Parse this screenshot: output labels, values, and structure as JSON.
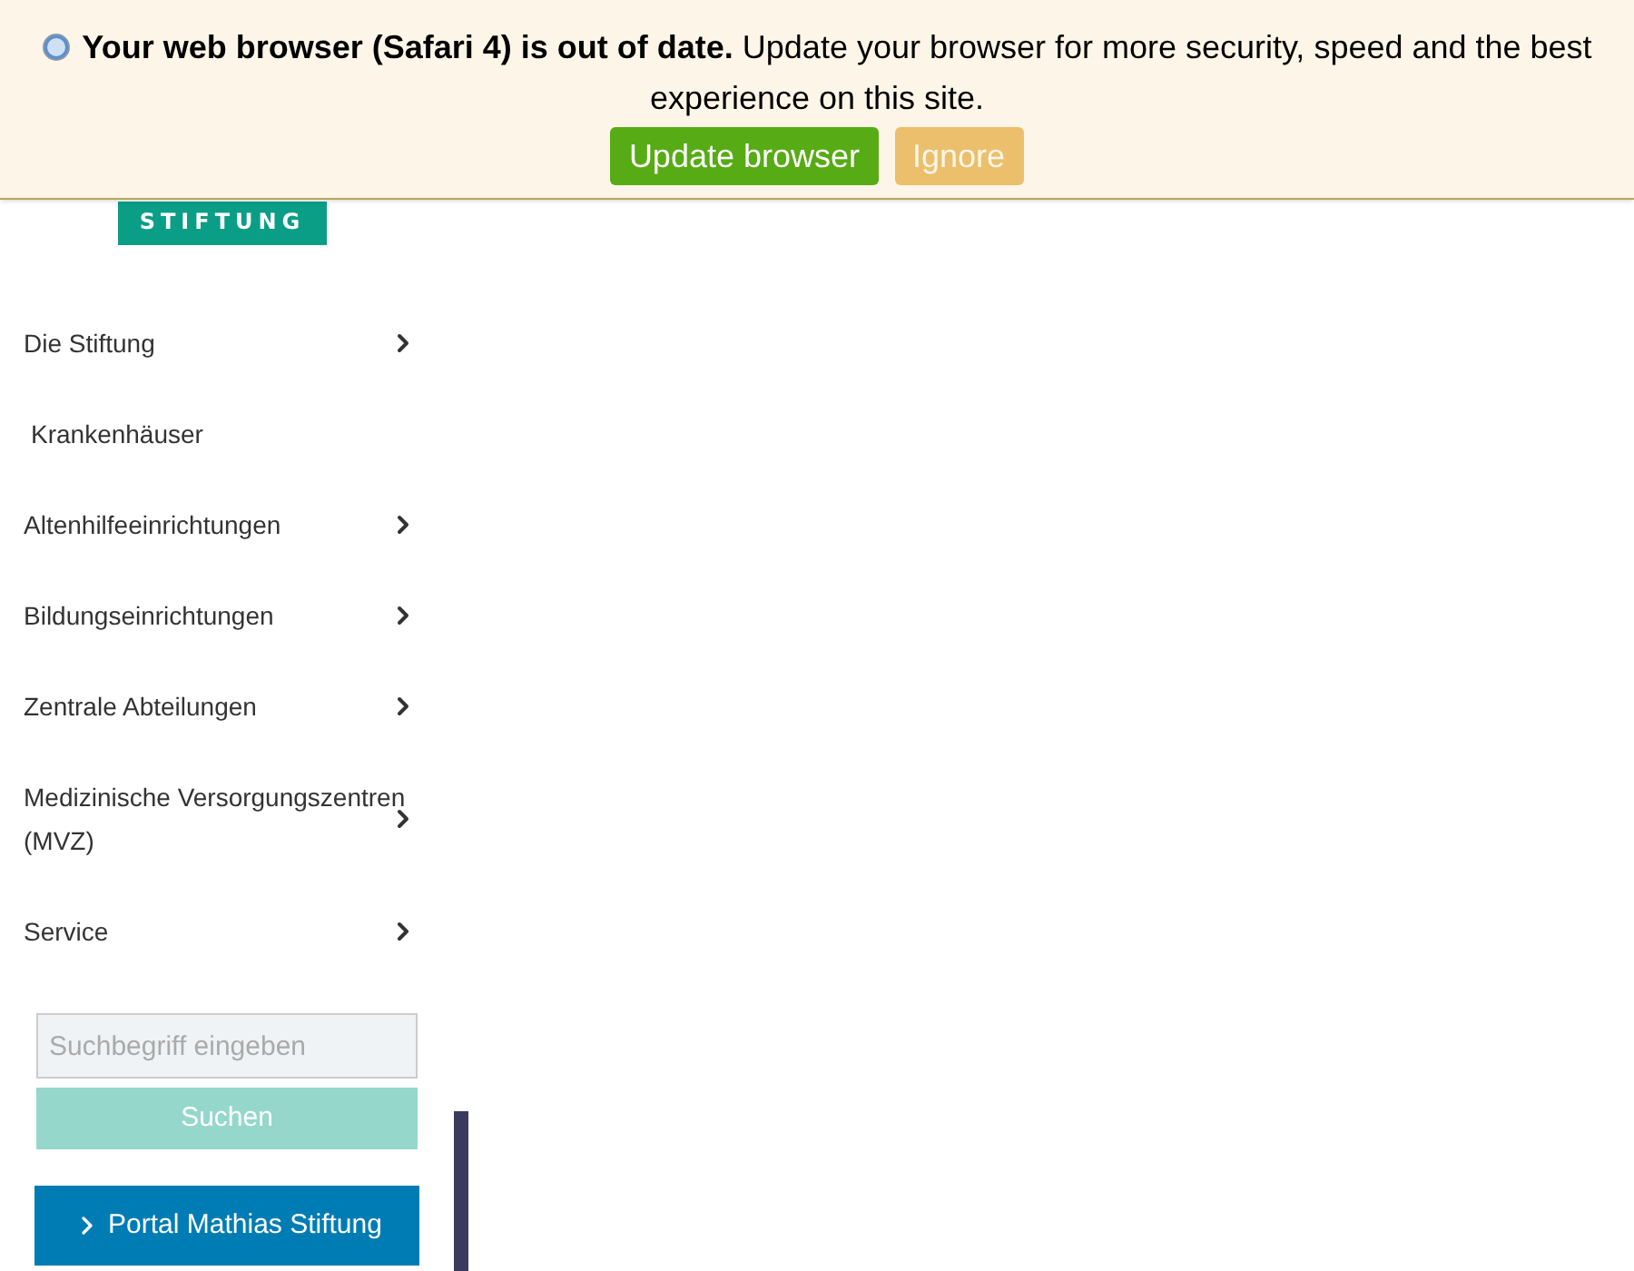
{
  "banner": {
    "message": "**Your web browser (Safari 4) is out of date.** Update your browser for more security, speed and the best experience on this site.",
    "buttons": [
      {
        "label": "Update browser",
        "kind": "primary"
      },
      {
        "label": "Ignore",
        "kind": "secondary"
      }
    ]
  },
  "logo": {
    "text": "STIFTUNG"
  },
  "nav": [
    {
      "label": "Die Stiftung",
      "has_submenu": true
    },
    {
      "label": "Krankenhäuser",
      "has_submenu": false
    },
    {
      "label": "Altenhilfeeinrichtungen",
      "has_submenu": true
    },
    {
      "label": "Bildungseinrichtungen",
      "has_submenu": true
    },
    {
      "label": "Zentrale Abteilungen",
      "has_submenu": true
    },
    {
      "label": "Medizinische Versorgungszentren (MVZ)",
      "has_submenu": true
    },
    {
      "label": "Service",
      "has_submenu": true
    }
  ],
  "search": {
    "placeholder": "Suchbegriff eingeben",
    "button": "Suchen"
  },
  "portal_link": "Portal Mathias Stiftung"
}
